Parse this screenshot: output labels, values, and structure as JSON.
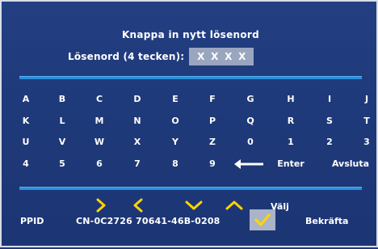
{
  "title": "Knappa in nytt lösenord",
  "password": {
    "label": "Lösenord (4 tecken):",
    "chars": [
      "X",
      "X",
      "X",
      "X"
    ]
  },
  "keyboard": {
    "rows": [
      [
        "A",
        "B",
        "C",
        "D",
        "E",
        "F",
        "G",
        "H",
        "I",
        "J"
      ],
      [
        "K",
        "L",
        "M",
        "N",
        "O",
        "P",
        "Q",
        "R",
        "S",
        "T"
      ],
      [
        "U",
        "V",
        "W",
        "X",
        "Y",
        "Z",
        "0",
        "1",
        "2",
        "3"
      ],
      [
        "4",
        "5",
        "6",
        "7",
        "8",
        "9"
      ]
    ],
    "enter_label": "Enter",
    "exit_label": "Avsluta"
  },
  "navigation": {
    "icons": [
      "chevron-right-icon",
      "chevron-left-icon",
      "chevron-down-icon",
      "chevron-up-icon"
    ],
    "select_label": "Välj"
  },
  "footer": {
    "ppid_label": "PPID",
    "ppid_value": "CN-0C2726 70641-46B-0208",
    "confirm_label": "Bekräfta"
  },
  "colors": {
    "background": "#1f3a7a",
    "rule": "#2b8fdc",
    "accent": "#ffd400",
    "field": "#9aa6bf"
  }
}
